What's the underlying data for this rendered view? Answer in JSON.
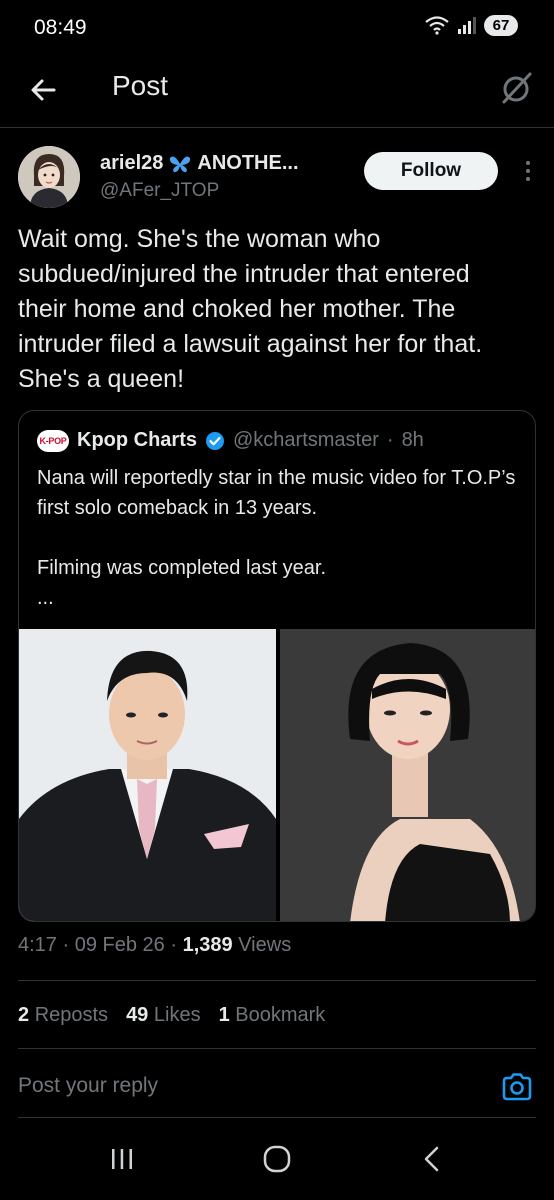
{
  "status_bar": {
    "time": "08:49",
    "battery": "67"
  },
  "header": {
    "title": "Post"
  },
  "author": {
    "name": "ariel28",
    "name_suffix": "ANOTHE...",
    "handle": "@AFer_JTOP",
    "follow_label": "Follow"
  },
  "post": {
    "text": "Wait omg. She's the woman who subdued/injured the intruder that entered their home and choked her mother. The intruder filed a lawsuit against her for that. She's a queen!"
  },
  "quote": {
    "logo_text": "K-POP",
    "name": "Kpop Charts",
    "handle": "@kchartsmaster",
    "time": "8h",
    "lines": [
      "Nana will reportedly star in the music video for T.O.P’s first solo comeback in 13 years.",
      "",
      "Filming was completed last year.",
      "..."
    ]
  },
  "meta": {
    "time": "4:17",
    "date": "09 Feb 26",
    "views_count": "1,389",
    "views_label": "Views"
  },
  "stats": {
    "reposts_count": "2",
    "reposts_label": "Reposts",
    "likes_count": "49",
    "likes_label": "Likes",
    "bookmarks_count": "1",
    "bookmarks_label": "Bookmark"
  },
  "reply": {
    "placeholder": "Post your reply"
  },
  "colors": {
    "background": "#000000",
    "text": "#e7e9ea",
    "secondary": "#71767b",
    "accent": "#1d9bf0",
    "divider": "#2f3336"
  },
  "icons": [
    "back-arrow-icon",
    "grok-icon",
    "butterfly-icon",
    "verified-badge-icon",
    "more-icon",
    "camera-icon",
    "recent-apps-icon",
    "home-icon",
    "nav-back-icon"
  ]
}
